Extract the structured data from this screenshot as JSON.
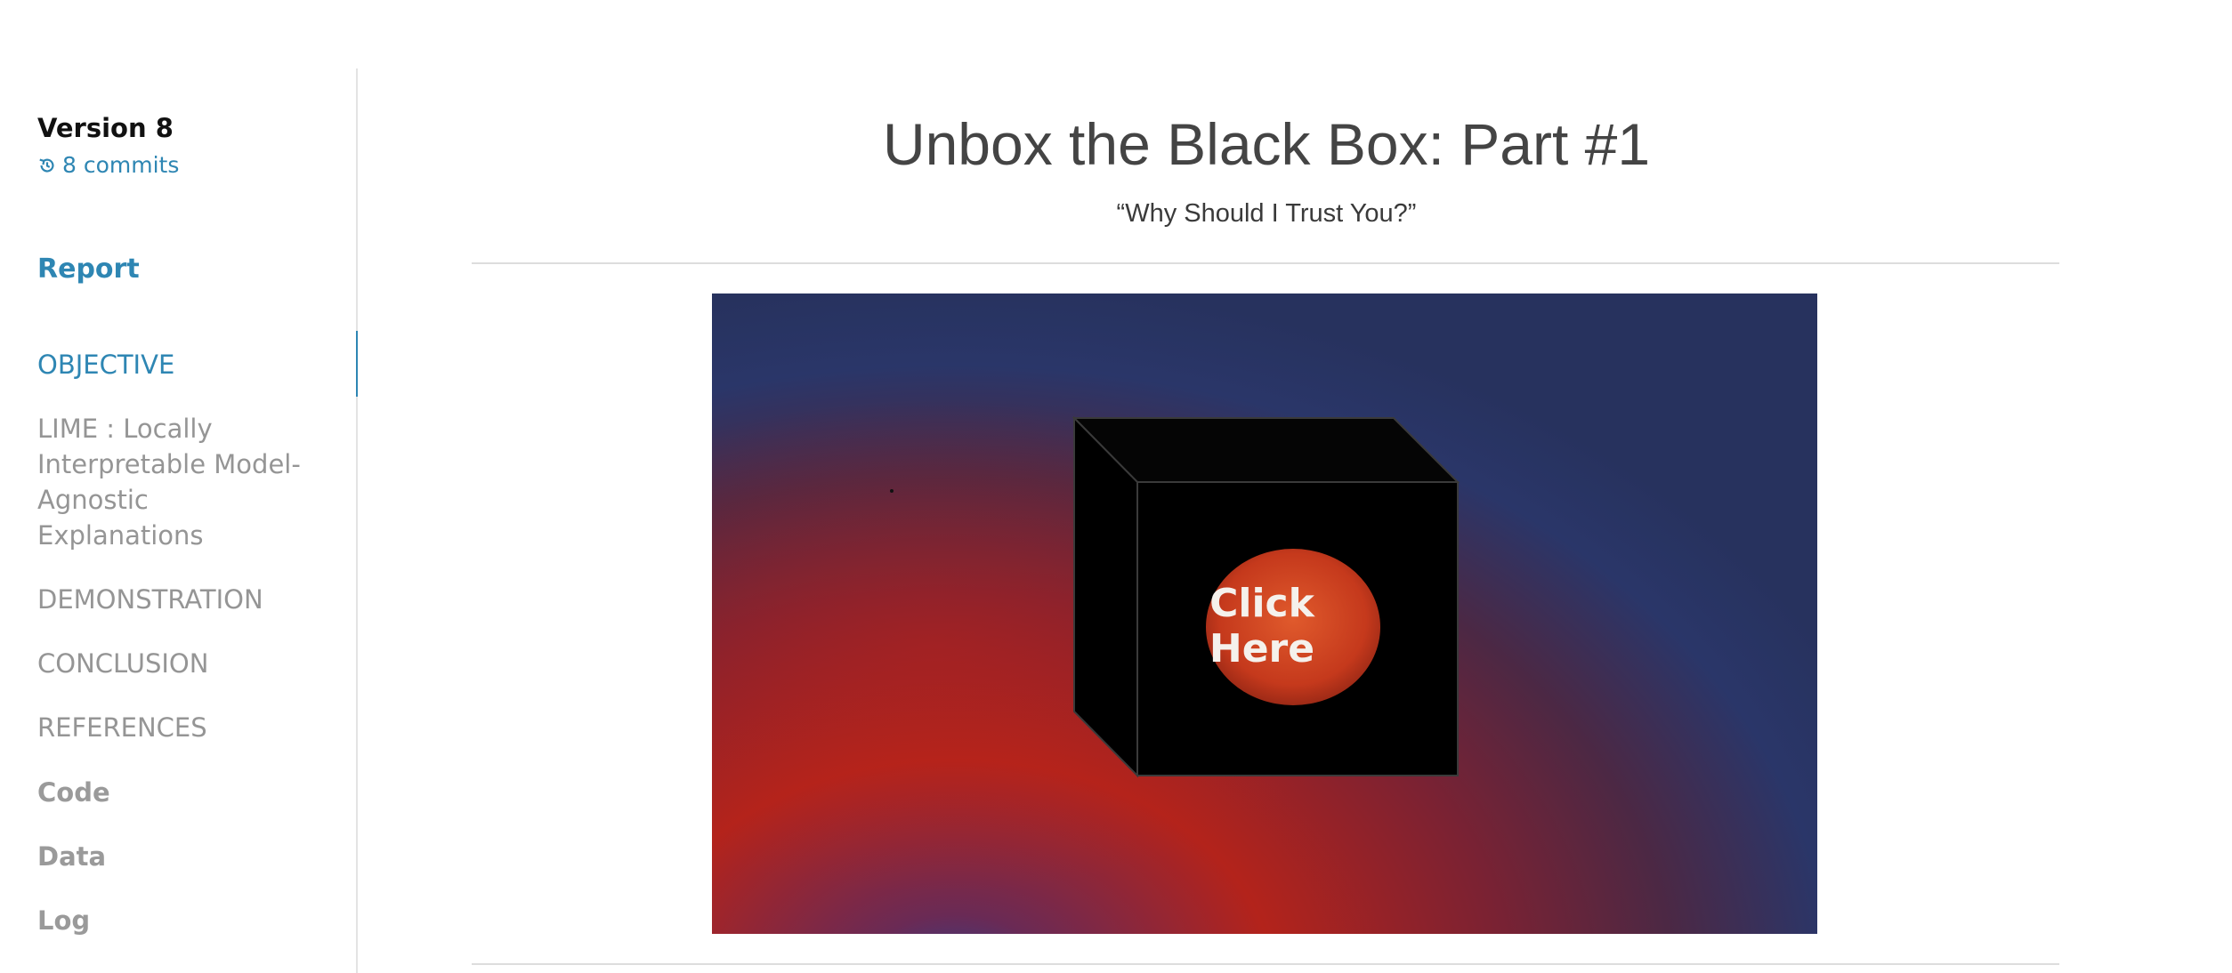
{
  "sidebar": {
    "version_title": "Version 8",
    "commits_label": "8 commits",
    "report_label": "Report",
    "toc": [
      {
        "label": "OBJECTIVE"
      },
      {
        "label": "LIME : Locally Interpretable Model-Agnostic Explanations"
      },
      {
        "label": "DEMONSTRATION"
      },
      {
        "label": "CONCLUSION"
      },
      {
        "label": "REFERENCES"
      }
    ],
    "bottom_nav": [
      {
        "label": "Code"
      },
      {
        "label": "Data"
      },
      {
        "label": "Log"
      }
    ]
  },
  "main": {
    "title": "Unbox the Black Box: Part #1",
    "subtitle": "“Why Should I Trust You?”",
    "hero": {
      "button_text": "Click Here"
    }
  },
  "colors": {
    "accent": "#2e86b3",
    "muted": "#959595",
    "title": "#444444"
  }
}
